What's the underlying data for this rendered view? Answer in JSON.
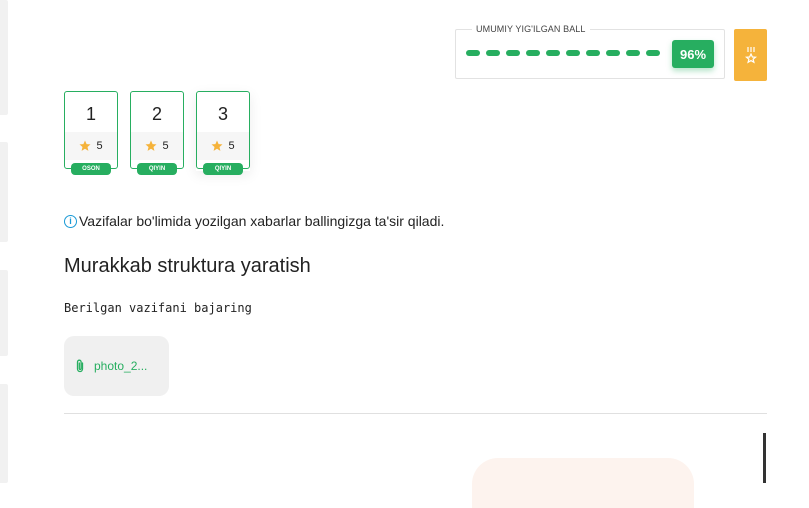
{
  "score": {
    "label": "UMUMIY YIG'ILGAN BALL",
    "percent_text": "96%",
    "percent": 96,
    "dash_count": 10,
    "accent": "#27ae60"
  },
  "medal": {
    "icon": "medal-icon",
    "color": "#f5b33b"
  },
  "tasks": [
    {
      "number": "1",
      "points": "5",
      "level": "OSON",
      "icon": "star-icon"
    },
    {
      "number": "2",
      "points": "5",
      "level": "QIYIN",
      "icon": "star-icon"
    },
    {
      "number": "3",
      "points": "5",
      "level": "QIYIN",
      "icon": "star-icon"
    }
  ],
  "info": {
    "icon": "info-icon",
    "text": "Vazifalar bo'limida yozilgan xabarlar ballingizga ta'sir qiladi."
  },
  "task_title": "Murakkab struktura yaratish",
  "task_description": "Berilgan vazifani bajaring",
  "attachment": {
    "icon": "paperclip-icon",
    "name": "photo_2..."
  },
  "colors": {
    "star": "#f5b33b",
    "info": "#1a9ad6"
  }
}
